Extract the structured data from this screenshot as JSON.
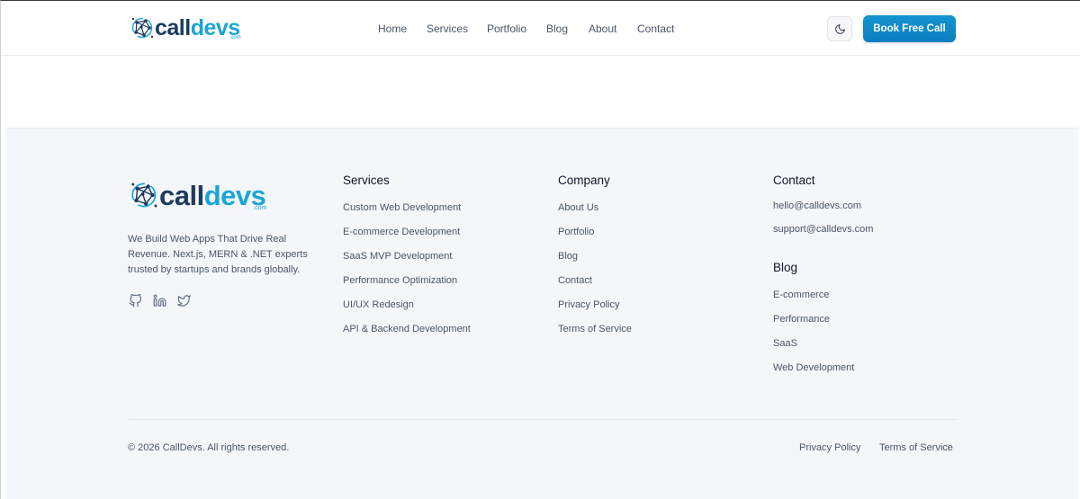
{
  "brand": {
    "logo_text_1": "call",
    "logo_text_2": "devs",
    "logo_suffix": ".com",
    "colors": {
      "primary": "#1e3a5f",
      "accent": "#1aa6d6",
      "button": "#0b7fbf"
    }
  },
  "header": {
    "nav": [
      "Home",
      "Services",
      "Portfolio",
      "Blog",
      "About",
      "Contact"
    ],
    "theme_toggle_icon": "moon-icon",
    "cta_label": "Book Free Call"
  },
  "footer": {
    "tagline": "We Build Web Apps That Drive Real Revenue. Next.js, MERN & .NET experts trusted by startups and brands globally.",
    "social_icons": [
      "github-icon",
      "linkedin-icon",
      "twitter-icon"
    ],
    "services": {
      "title": "Services",
      "links": [
        "Custom Web Development",
        "E-commerce Development",
        "SaaS MVP Development",
        "Performance Optimization",
        "UI/UX Redesign",
        "API & Backend Development"
      ]
    },
    "company": {
      "title": "Company",
      "links": [
        "About Us",
        "Portfolio",
        "Blog",
        "Contact",
        "Privacy Policy",
        "Terms of Service"
      ]
    },
    "contact": {
      "title": "Contact",
      "emails": [
        "hello@calldevs.com",
        "support@calldevs.com"
      ]
    },
    "blog": {
      "title": "Blog",
      "links": [
        "E-commerce",
        "Performance",
        "SaaS",
        "Web Development"
      ]
    },
    "copyright": "© 2026 CallDevs. All rights reserved.",
    "bottom_links": [
      "Privacy Policy",
      "Terms of Service"
    ]
  }
}
